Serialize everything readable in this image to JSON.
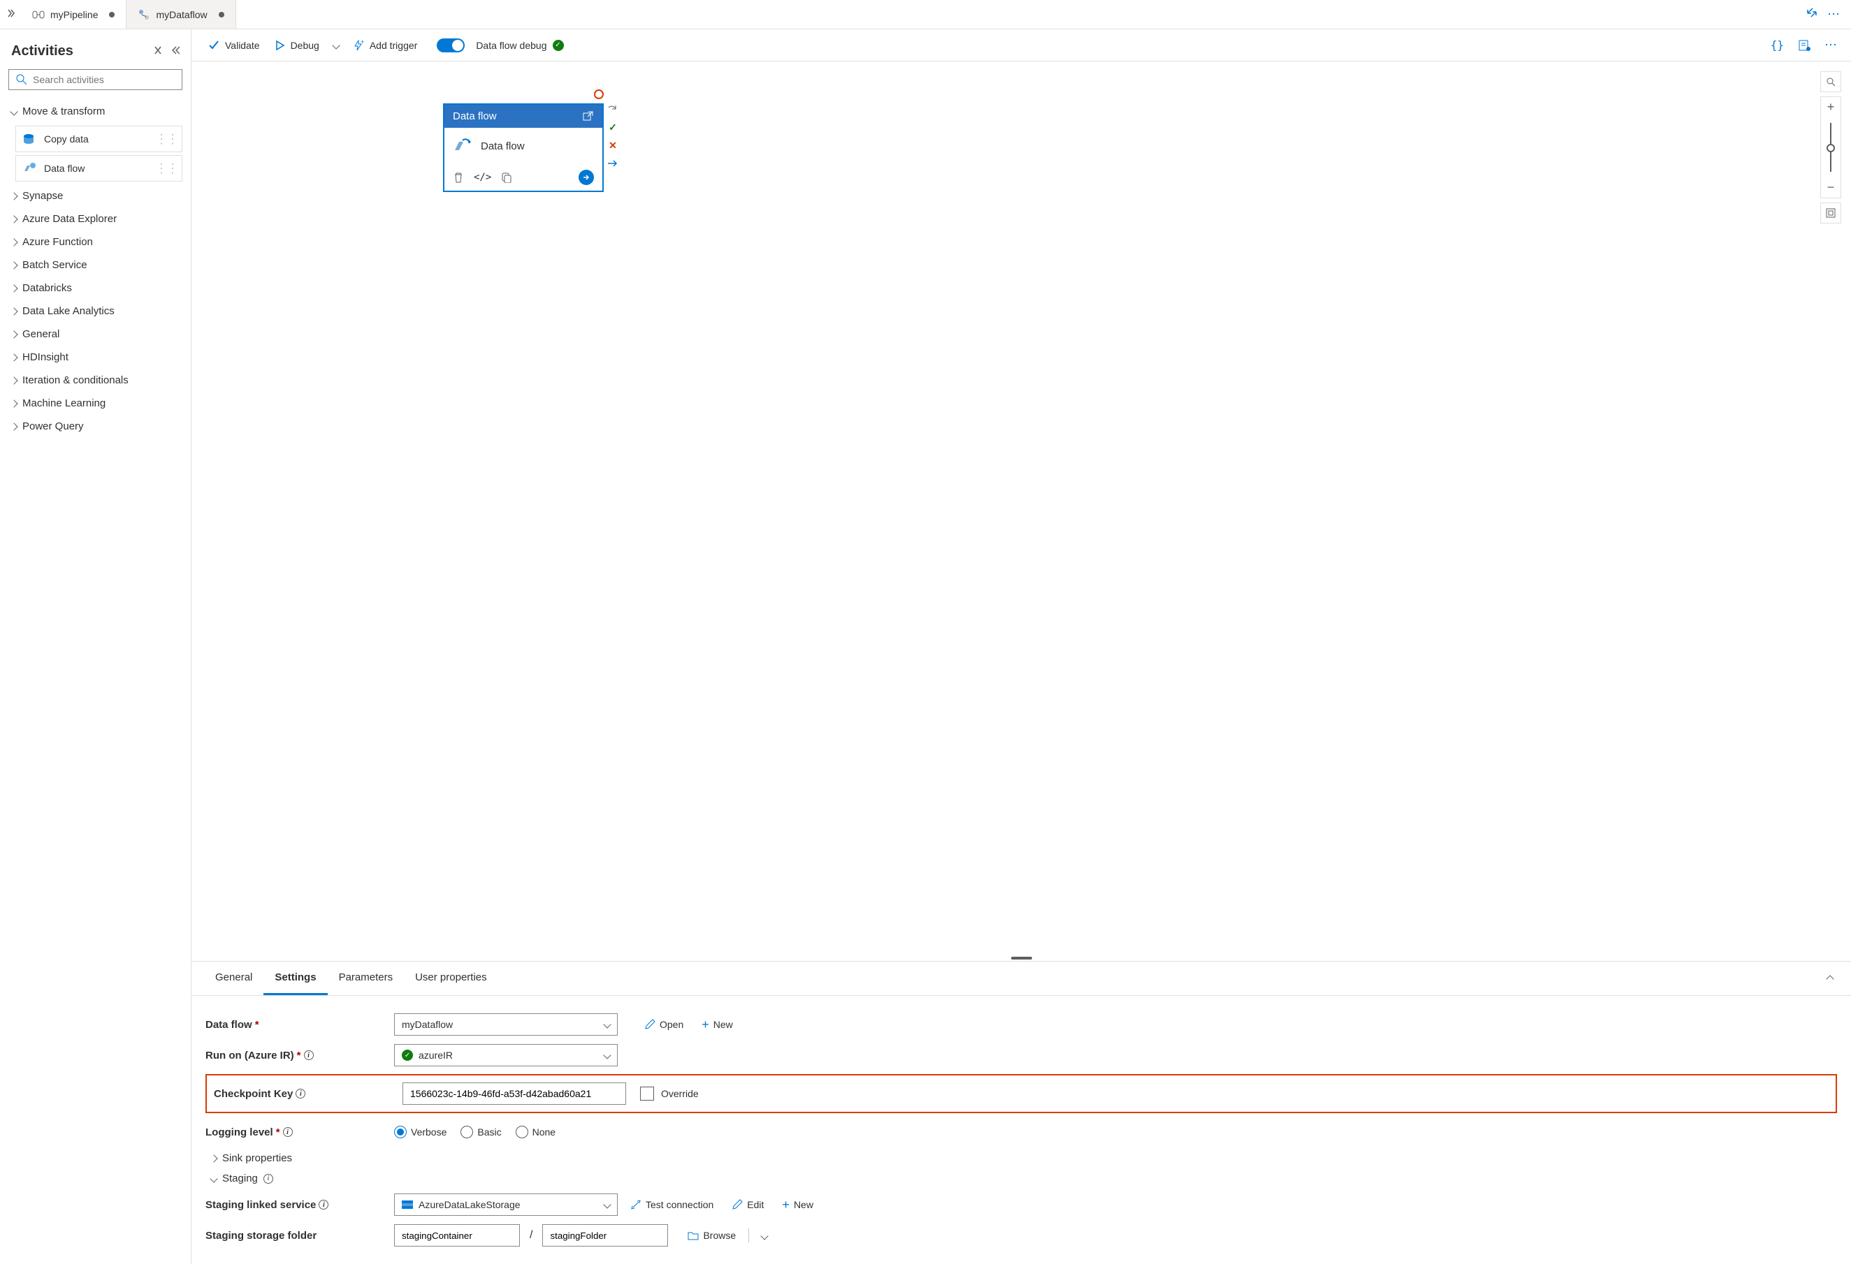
{
  "tabs": [
    {
      "label": "myPipeline",
      "icon": "pipeline",
      "active": true,
      "dirty": true
    },
    {
      "label": "myDataflow",
      "icon": "dataflow",
      "active": false,
      "dirty": true
    }
  ],
  "sidebar": {
    "title": "Activities",
    "searchPlaceholder": "Search activities",
    "expanded": {
      "label": "Move & transform",
      "items": [
        {
          "label": "Copy data",
          "icon": "copy-data"
        },
        {
          "label": "Data flow",
          "icon": "dataflow"
        }
      ]
    },
    "categories": [
      "Synapse",
      "Azure Data Explorer",
      "Azure Function",
      "Batch Service",
      "Databricks",
      "Data Lake Analytics",
      "General",
      "HDInsight",
      "Iteration & conditionals",
      "Machine Learning",
      "Power Query"
    ]
  },
  "toolbar": {
    "validate": "Validate",
    "debug": "Debug",
    "addTrigger": "Add trigger",
    "dataflowDebug": "Data flow debug"
  },
  "node": {
    "title": "Data flow",
    "name": "Data flow"
  },
  "details": {
    "tabs": [
      "General",
      "Settings",
      "Parameters",
      "User properties"
    ],
    "activeTab": "Settings"
  },
  "form": {
    "dataflow": {
      "label": "Data flow",
      "value": "myDataflow",
      "open": "Open",
      "new": "New"
    },
    "runon": {
      "label": "Run on (Azure IR)",
      "value": "azureIR"
    },
    "checkpoint": {
      "label": "Checkpoint Key",
      "value": "1566023c-14b9-46fd-a53f-d42abad60a21",
      "override": "Override"
    },
    "logging": {
      "label": "Logging level",
      "options": [
        "Verbose",
        "Basic",
        "None"
      ],
      "selected": "Verbose"
    },
    "sinkProps": "Sink properties",
    "staging": "Staging",
    "stagingService": {
      "label": "Staging linked service",
      "value": "AzureDataLakeStorage",
      "test": "Test connection",
      "edit": "Edit",
      "new": "New"
    },
    "stagingFolder": {
      "label": "Staging storage folder",
      "container": "stagingContainer",
      "path": "stagingFolder",
      "browse": "Browse"
    }
  }
}
